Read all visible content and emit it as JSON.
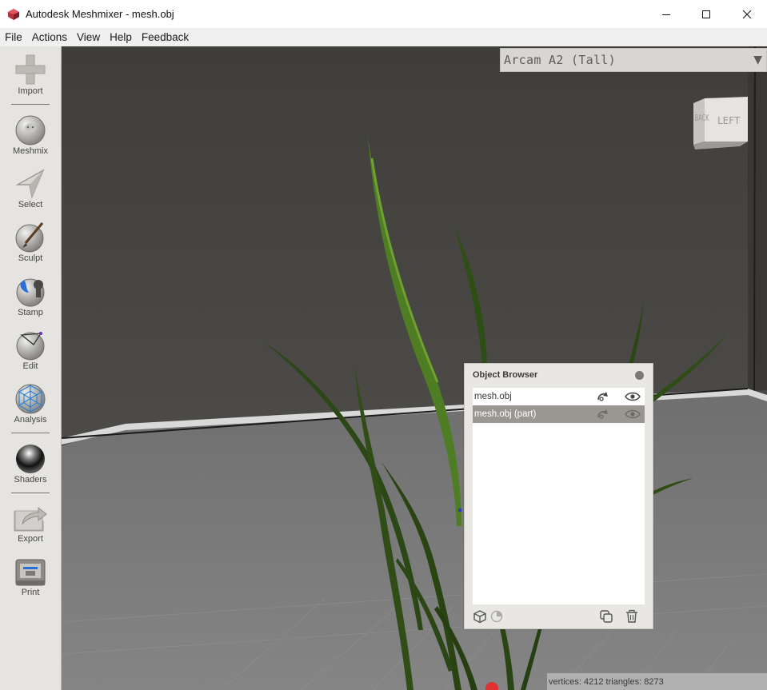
{
  "window": {
    "title": "Autodesk Meshmixer - mesh.obj",
    "controls": {
      "minimize": "—",
      "maximize": "☐",
      "close": "✕"
    }
  },
  "menu": [
    {
      "label": "File"
    },
    {
      "label": "Actions"
    },
    {
      "label": "View"
    },
    {
      "label": "Help"
    },
    {
      "label": "Feedback"
    }
  ],
  "toolbar": {
    "items": [
      {
        "label": "Import",
        "icon": "plus-icon"
      },
      {
        "label": "Meshmix",
        "icon": "bunny-sphere-icon"
      },
      {
        "label": "Select",
        "icon": "arrow-cursor-icon"
      },
      {
        "label": "Sculpt",
        "icon": "brush-sphere-icon"
      },
      {
        "label": "Stamp",
        "icon": "stamp-sphere-icon"
      },
      {
        "label": "Edit",
        "icon": "edit-sphere-icon"
      },
      {
        "label": "Analysis",
        "icon": "analysis-sphere-icon"
      },
      {
        "label": "Shaders",
        "icon": "chrome-sphere-icon"
      },
      {
        "label": "Export",
        "icon": "export-icon"
      },
      {
        "label": "Print",
        "icon": "printer-icon"
      }
    ]
  },
  "viewport": {
    "printer": "Arcam A2 (Tall)",
    "viewcube": {
      "front_face": "LEFT",
      "side_face": "BACK"
    },
    "colors": {
      "background": "#4a4846",
      "floor": "#7a7a7a",
      "grass": "#2d4a1a",
      "grass_highlight": "#5a8a2a"
    }
  },
  "object_browser": {
    "title": "Object Browser",
    "objects": [
      {
        "name": "mesh.obj",
        "selected": false
      },
      {
        "name": "mesh.obj (part)",
        "selected": true
      }
    ]
  },
  "status": {
    "text": "vertices: 4212 triangles: 8273"
  }
}
